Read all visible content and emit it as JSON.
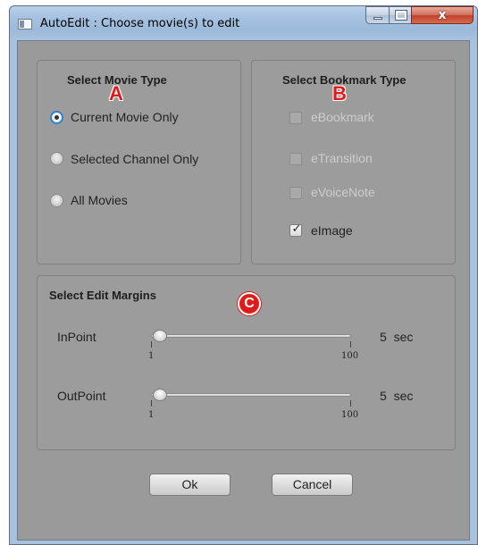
{
  "window": {
    "title": "AutoEdit : Choose movie(s) to edit",
    "close_glyph": "x"
  },
  "movie_type": {
    "title": "Select Movie Type",
    "marker": "A",
    "options": [
      {
        "label": "Current Movie Only",
        "selected": true
      },
      {
        "label": "Selected Channel Only",
        "selected": false
      },
      {
        "label": "All Movies",
        "selected": false
      }
    ]
  },
  "bookmark_type": {
    "title": "Select Bookmark Type",
    "marker": "B",
    "options": [
      {
        "label": "eBookmark",
        "checked": false,
        "enabled": false
      },
      {
        "label": "eTransition",
        "checked": false,
        "enabled": false
      },
      {
        "label": "eVoiceNote",
        "checked": false,
        "enabled": false
      },
      {
        "label": "eImage",
        "checked": true,
        "enabled": true
      }
    ]
  },
  "margins": {
    "title": "Select Edit Margins",
    "marker": "C",
    "sliders": [
      {
        "label": "InPoint",
        "min_label": "1",
        "max_label": "100",
        "value": 5,
        "value_text": "5  sec"
      },
      {
        "label": "OutPoint",
        "min_label": "1",
        "max_label": "100",
        "value": 5,
        "value_text": "5  sec"
      }
    ]
  },
  "buttons": {
    "ok": "Ok",
    "cancel": "Cancel"
  },
  "colors": {
    "marker_red": "#e01a1a",
    "radio_focus": "#2d83cf",
    "close_red": "#c1412b"
  }
}
